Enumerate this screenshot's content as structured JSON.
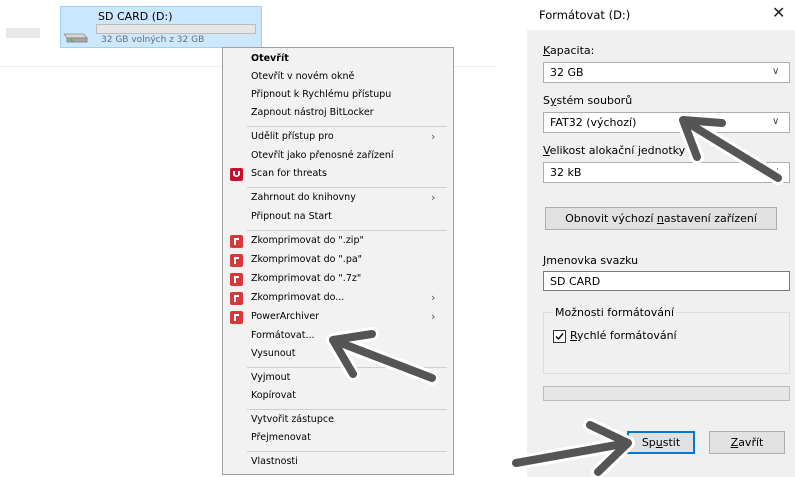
{
  "explorer": {
    "drive_name": "SD CARD (D:)",
    "drive_free": "32 GB volných z 32 GB",
    "drive_used_fraction": 0.0,
    "drive_icon": "usb-drive-icon",
    "selection_color": "#cce8ff"
  },
  "context_menu": {
    "items": {
      "open": "Otevřít",
      "open_new_window": "Otevřít v novém okně",
      "pin_quick_access": "Připnout k Rychlému přístupu",
      "bitlocker": "Zapnout nástroj BitLocker",
      "give_access": "Udělit přístup pro",
      "open_portable": "Otevřít jako přenosné zařízení",
      "scan_threats": "Scan for threats",
      "include_library": "Zahrnout do knihovny",
      "pin_start": "Připnout na Start",
      "compress_zip": "Zkomprimovat do \".zip\"",
      "compress_pa": "Zkomprimovat do \".pa\"",
      "compress_7z": "Zkomprimovat do \".7z\"",
      "compress_to": "Zkomprimovat do...",
      "powerarchiver": "PowerArchiver",
      "format": "Formátovat...",
      "eject": "Vysunout",
      "cut": "Vyjmout",
      "copy": "Kopírovat",
      "create_shortcut": "Vytvořit zástupce",
      "rename": "Přejmenovat",
      "properties": "Vlastnosti"
    },
    "icons": {
      "scan": "mcafee-shield-icon",
      "archiver": "powerarchiver-icon"
    },
    "colors": {
      "scan": "#c8102e",
      "archiver": "#d9383a"
    }
  },
  "format_dialog": {
    "title": "Formátovat (D:)",
    "close_icon": "close-icon",
    "capacity": {
      "label_prefix": "",
      "label_key": "K",
      "label_rest": "apacita:",
      "value": "32 GB"
    },
    "filesystem": {
      "label_prefix": "S",
      "label_key": "y",
      "label_rest": "stém souborů",
      "value": "FAT32 (výchozí)"
    },
    "allocation": {
      "label_prefix": "",
      "label_key": "V",
      "label_rest": "elikost alokační jednotky",
      "value": "32 kB"
    },
    "restore_button": {
      "prefix": "Obnovit výchozí ",
      "key": "n",
      "rest": "astavení zařízení"
    },
    "volume_label": {
      "label_prefix": "",
      "label_key": "J",
      "label_rest": "menovka svazku",
      "value": "SD CARD"
    },
    "options_group": "Možnosti formátování",
    "quick_format": {
      "prefix": "",
      "key": "R",
      "rest": "ychlé formátování",
      "checked": true
    },
    "progress_fraction": 0.0,
    "start_button": {
      "prefix": "Sp",
      "key": "u",
      "rest": "stit"
    },
    "close_button": {
      "prefix": "",
      "key": "Z",
      "rest": "avřít"
    }
  }
}
